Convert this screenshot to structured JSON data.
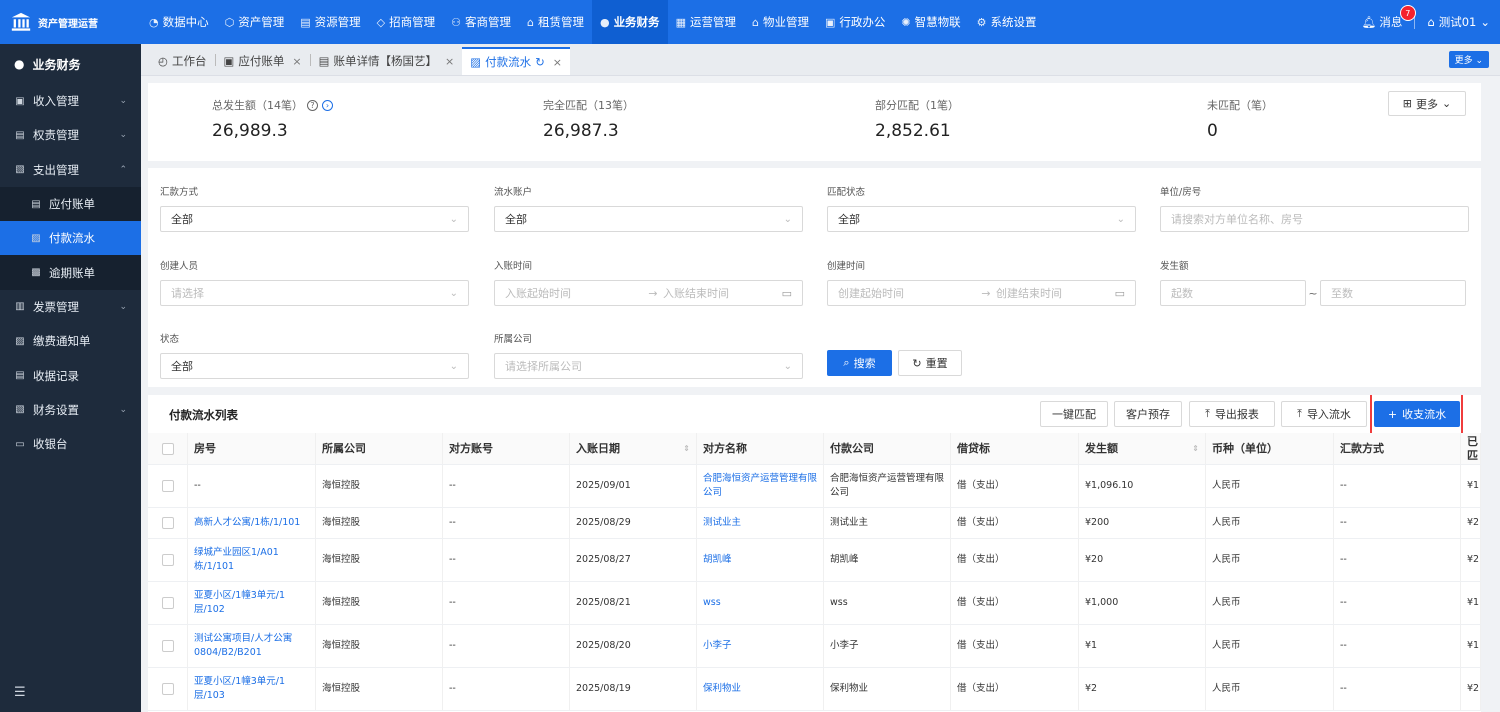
{
  "app": {
    "title": "资产管理运营"
  },
  "topnav": [
    {
      "label": "数据中心",
      "icon": "◔"
    },
    {
      "label": "资产管理",
      "icon": "⬡"
    },
    {
      "label": "资源管理",
      "icon": "▤"
    },
    {
      "label": "招商管理",
      "icon": "◇"
    },
    {
      "label": "客商管理",
      "icon": "⚇"
    },
    {
      "label": "租赁管理",
      "icon": "⌂"
    },
    {
      "label": "业务财务",
      "icon": "●",
      "active": true
    },
    {
      "label": "运营管理",
      "icon": "▦"
    },
    {
      "label": "物业管理",
      "icon": "⌂"
    },
    {
      "label": "行政办公",
      "icon": "▣"
    },
    {
      "label": "智慧物联",
      "icon": "✺"
    },
    {
      "label": "系统设置",
      "icon": "⚙"
    }
  ],
  "user": {
    "messages_label": "消息",
    "message_count": "7",
    "name": "测试01"
  },
  "sidebar": {
    "header": "业务财务",
    "items": [
      {
        "label": "收入管理",
        "icon": "▣",
        "chev": "⌄"
      },
      {
        "label": "权责管理",
        "icon": "▤",
        "chev": "⌄"
      },
      {
        "label": "支出管理",
        "icon": "▧",
        "chev": "⌃"
      },
      {
        "label": "应付账单",
        "icon": "▤",
        "sub": true
      },
      {
        "label": "付款流水",
        "icon": "▨",
        "sub": true,
        "active": true
      },
      {
        "label": "逾期账单",
        "icon": "▩",
        "sub": true
      },
      {
        "label": "发票管理",
        "icon": "▥",
        "chev": "⌄"
      },
      {
        "label": "缴费通知单",
        "icon": "▨"
      },
      {
        "label": "收据记录",
        "icon": "▤"
      },
      {
        "label": "财务设置",
        "icon": "▧",
        "chev": "⌄"
      },
      {
        "label": "收银台",
        "icon": "▭"
      }
    ],
    "footer_icon": "☰"
  },
  "tabs": [
    {
      "label": "工作台",
      "icon": "◴"
    },
    {
      "label": "应付账单",
      "icon": "▣",
      "close": "×"
    },
    {
      "label": "账单详情【杨国艺】",
      "icon": "▤",
      "close": "×"
    },
    {
      "label": "付款流水",
      "icon": "▨",
      "refresh": "↻",
      "close": "×",
      "active": true
    }
  ],
  "tabs_more": "更多 ⌄",
  "summary": {
    "total_label": "总发生额（14笔）",
    "total_value": "26,989.3",
    "full_label": "完全匹配（13笔）",
    "full_value": "26,987.3",
    "partial_label": "部分匹配（1笔）",
    "partial_value": "2,852.61",
    "none_label": "未匹配（笔）",
    "none_value": "0",
    "more_label": "更多"
  },
  "filters": {
    "remit_method": {
      "label": "汇款方式",
      "value": "全部"
    },
    "account": {
      "label": "流水账户",
      "value": "全部"
    },
    "match_status": {
      "label": "匹配状态",
      "value": "全部"
    },
    "unit": {
      "label": "单位/房号",
      "placeholder": "请搜索对方单位名称、房号"
    },
    "creator": {
      "label": "创建人员",
      "placeholder": "请选择"
    },
    "entry_time": {
      "label": "入账时间",
      "start": "入账起始时间",
      "end": "入账结束时间"
    },
    "create_time": {
      "label": "创建时间",
      "start": "创建起始时间",
      "end": "创建结束时间"
    },
    "amount": {
      "label": "发生额",
      "from": "起数",
      "to": "至数",
      "sep": "~"
    },
    "status": {
      "label": "状态",
      "value": "全部"
    },
    "company": {
      "label": "所属公司",
      "placeholder": "请选择所属公司"
    },
    "search_label": "搜索",
    "reset_label": "重置"
  },
  "list": {
    "title": "付款流水列表",
    "buttons": {
      "match": "一键匹配",
      "prepay": "客户预存",
      "export": "导出报表",
      "import": "导入流水",
      "add": "收支流水"
    },
    "columns": [
      "房号",
      "所属公司",
      "对方账号",
      "入账日期",
      "对方名称",
      "付款公司",
      "借贷标",
      "发生额",
      "币种（单位）",
      "汇款方式",
      "已匹"
    ],
    "rows": [
      {
        "room": "--",
        "company": "海恒控股",
        "account": "--",
        "date": "2025/09/01",
        "party": "合肥海恒资产运营管理有限公司",
        "payer": "合肥海恒资产运营管理有限公司",
        "flag": "借（支出）",
        "amount": "¥1,096.10",
        "currency": "人民币",
        "method": "--",
        "matched": "¥1"
      },
      {
        "room": "高新人才公寓/1栋/1/101",
        "company": "海恒控股",
        "account": "--",
        "date": "2025/08/29",
        "party": "测试业主",
        "payer": "测试业主",
        "flag": "借（支出）",
        "amount": "¥200",
        "currency": "人民币",
        "method": "--",
        "matched": "¥2"
      },
      {
        "room": "绿城产业园区1/A01栋/1/101",
        "company": "海恒控股",
        "account": "--",
        "date": "2025/08/27",
        "party": "胡凯峰",
        "payer": "胡凯峰",
        "flag": "借（支出）",
        "amount": "¥20",
        "currency": "人民币",
        "method": "--",
        "matched": "¥2"
      },
      {
        "room": "亚夏小区/1幢3单元/1层/102",
        "company": "海恒控股",
        "account": "--",
        "date": "2025/08/21",
        "party": "wss",
        "payer": "wss",
        "flag": "借（支出）",
        "amount": "¥1,000",
        "currency": "人民币",
        "method": "--",
        "matched": "¥1"
      },
      {
        "room": "测试公寓项目/人才公寓0804/B2/B201",
        "company": "海恒控股",
        "account": "--",
        "date": "2025/08/20",
        "party": "小李子",
        "payer": "小李子",
        "flag": "借（支出）",
        "amount": "¥1",
        "currency": "人民币",
        "method": "--",
        "matched": "¥1"
      },
      {
        "room": "亚夏小区/1幢3单元/1层/103",
        "company": "海恒控股",
        "account": "--",
        "date": "2025/08/19",
        "party": "保利物业",
        "payer": "保利物业",
        "flag": "借（支出）",
        "amount": "¥2",
        "currency": "人民币",
        "method": "--",
        "matched": "¥2"
      }
    ]
  },
  "colors": {
    "primary": "#1c6fe6",
    "sidebar": "#1e2b3c",
    "highlight": "#f03c3c"
  }
}
